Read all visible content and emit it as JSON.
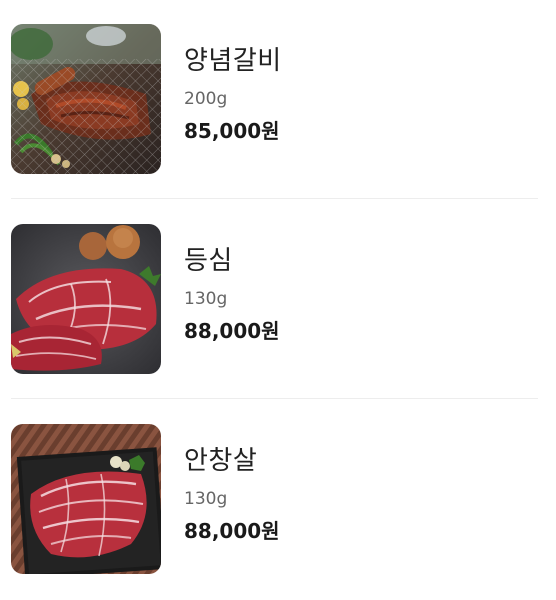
{
  "menu": {
    "items": [
      {
        "name": "양념갈비",
        "weight": "200g",
        "price": "85,000원",
        "image": "marinated-galbi-grill-photo"
      },
      {
        "name": "등심",
        "weight": "130g",
        "price": "88,000원",
        "image": "sirloin-raw-beef-photo"
      },
      {
        "name": "안창살",
        "weight": "130g",
        "price": "88,000원",
        "image": "skirt-steak-raw-beef-photo"
      }
    ]
  },
  "colors": {
    "name_text": "#222222",
    "weight_text": "#666666",
    "price_text": "#1a1a1a",
    "divider": "#ededed",
    "background": "#ffffff"
  }
}
